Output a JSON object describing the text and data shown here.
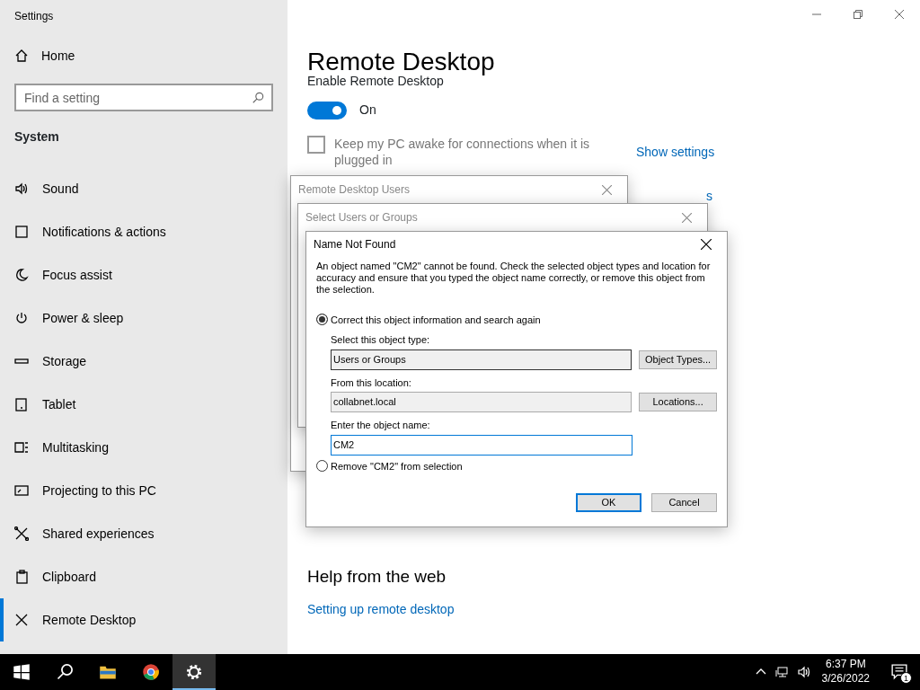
{
  "window": {
    "title": "Settings"
  },
  "sidebar": {
    "home": "Home",
    "search": {
      "placeholder": "Find a setting"
    },
    "section": "System",
    "items": [
      {
        "label": "Sound",
        "kind": "sound",
        "selected": false
      },
      {
        "label": "Notifications & actions",
        "kind": "notifications",
        "selected": false
      },
      {
        "label": "Focus assist",
        "kind": "moon",
        "selected": false
      },
      {
        "label": "Power & sleep",
        "kind": "power",
        "selected": false
      },
      {
        "label": "Storage",
        "kind": "storage",
        "selected": false
      },
      {
        "label": "Tablet",
        "kind": "tablet",
        "selected": false
      },
      {
        "label": "Multitasking",
        "kind": "multitasking",
        "selected": false
      },
      {
        "label": "Projecting to this PC",
        "kind": "projecting",
        "selected": false
      },
      {
        "label": "Shared experiences",
        "kind": "shared",
        "selected": false
      },
      {
        "label": "Clipboard",
        "kind": "clipboard",
        "selected": false
      },
      {
        "label": "Remote Desktop",
        "kind": "remote",
        "selected": true
      }
    ]
  },
  "main": {
    "title": "Remote Desktop",
    "enable_label": "Enable Remote Desktop",
    "toggle": {
      "on": true,
      "label": "On"
    },
    "keep_awake": {
      "checked": false,
      "label": "Keep my PC awake for connections when it is plugged in"
    },
    "show_settings": "Show settings",
    "partial_link": "s",
    "help_heading": "Help from the web",
    "help_links": [
      "Setting up remote desktop"
    ]
  },
  "dialogs": [
    {
      "title": "Remote Desktop Users"
    },
    {
      "title": "Select Users or Groups"
    }
  ],
  "name_not_found": {
    "title": "Name Not Found",
    "message": "An object named \"CM2\" cannot be found. Check the selected object types and location for accuracy and ensure that you typed the object name correctly, or remove this object from the selection.",
    "options": [
      {
        "label": "Correct this object information and search again",
        "selected": true
      },
      {
        "label": "Remove \"CM2\" from selection",
        "selected": false
      }
    ],
    "object_type": {
      "label": "Select this object type:",
      "value": "Users or Groups",
      "button": "Object Types..."
    },
    "location": {
      "label": "From this location:",
      "value": "collabnet.local",
      "button": "Locations..."
    },
    "object_name": {
      "label": "Enter the object name:",
      "value": "CM2"
    },
    "buttons": [
      {
        "label": "OK",
        "default": true
      },
      {
        "label": "Cancel",
        "default": false
      }
    ]
  },
  "taskbar": {
    "apps": [
      {
        "kind": "start",
        "selected": false
      },
      {
        "kind": "search",
        "selected": false
      },
      {
        "kind": "folder",
        "selected": false
      },
      {
        "kind": "browser",
        "selected": false
      },
      {
        "kind": "settings",
        "selected": true
      }
    ],
    "time": "6:37 PM",
    "date": "3/26/2022",
    "notifications": "1"
  }
}
